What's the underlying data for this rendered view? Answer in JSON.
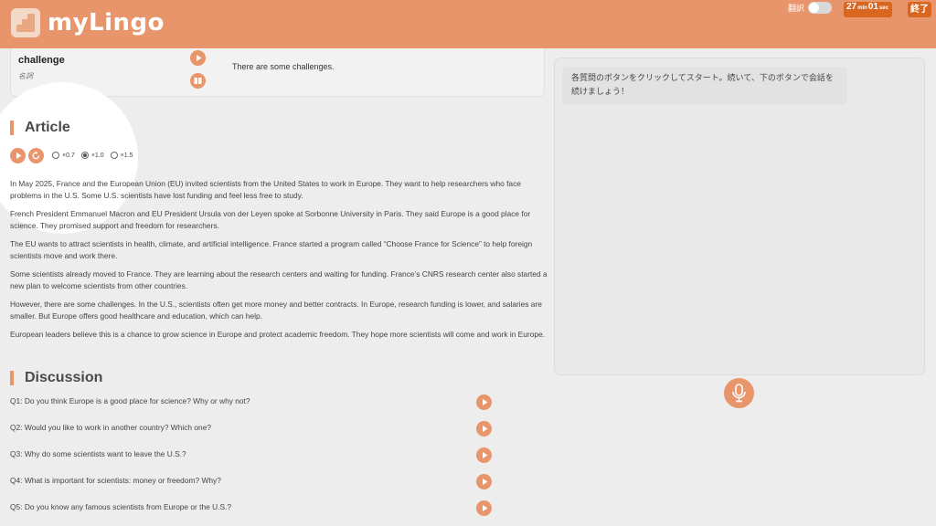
{
  "app": {
    "name": "myLingo",
    "translate_label": "翻訳",
    "timer": {
      "minutes": "27",
      "min_unit": "min",
      "seconds": "01",
      "sec_unit": "sec"
    },
    "end_label": "終了"
  },
  "vocab": {
    "word": "challenge",
    "pos": "名詞",
    "sentence": "There are some challenges."
  },
  "article": {
    "title": "Article",
    "speeds": [
      "×0.7",
      "×1.0",
      "×1.5"
    ],
    "selected_speed": "×1.0",
    "paragraphs": [
      "In May 2025, France and the European Union (EU) invited scientists from the United States to work in Europe. They want to help researchers who face problems in the U.S. Some U.S. scientists have lost funding and feel less free to study.",
      "French President Emmanuel Macron and EU President Ursula von der Leyen spoke at Sorbonne University in Paris. They said Europe is a good place for science. They promised support and freedom for researchers.",
      "The EU wants to attract scientists in health, climate, and artificial intelligence. France started a program called “Choose France for Science” to help foreign scientists move and work there.",
      "Some scientists already moved to France. They are learning about the research centers and waiting for funding. France’s CNRS research center also started a new plan to welcome scientists from other countries.",
      "However, there are some challenges. In the U.S., scientists often get more money and better contracts. In Europe, research funding is lower, and salaries are smaller. But Europe offers good healthcare and education, which can help.",
      "European leaders believe this is a chance to grow science in Europe and protect academic freedom. They hope more scientists will come and work in Europe."
    ]
  },
  "discussion": {
    "title": "Discussion",
    "questions": [
      "Q1: Do you think Europe is a good place for science? Why or why not?",
      "Q2: Would you like to work in another country? Which one?",
      "Q3: Why do some scientists want to leave the U.S.?",
      "Q4: What is important for scientists: money or freedom? Why?",
      "Q5: Do you know any famous scientists from Europe or the U.S.?"
    ]
  },
  "chat": {
    "message": "各質問のボタンをクリックしてスタート。続いて、下のボタンで会話を続けましょう！"
  },
  "colors": {
    "accent": "#e8956b",
    "accent_dark": "#d9661f",
    "background": "#ededed"
  },
  "icons": [
    "logo-icon",
    "play-icon",
    "book-icon",
    "replay-icon",
    "microphone-icon"
  ]
}
